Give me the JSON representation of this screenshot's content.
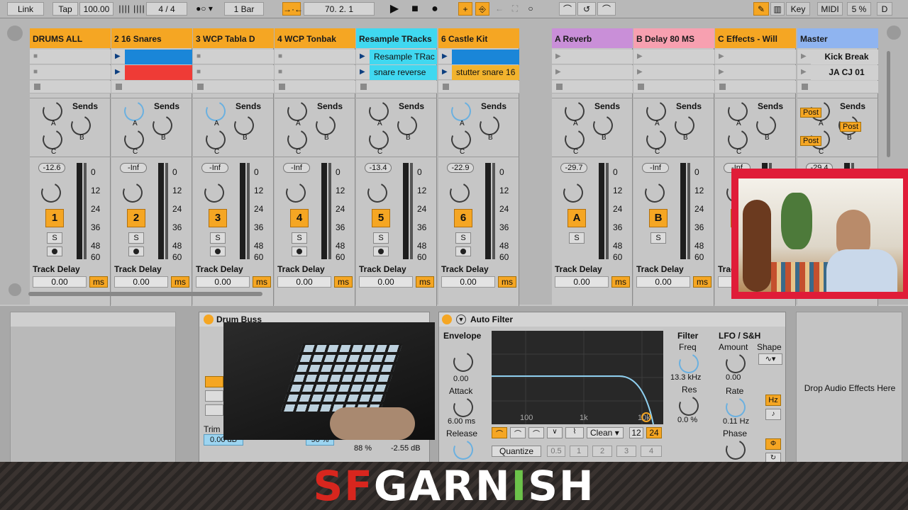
{
  "topbar": {
    "link": "Link",
    "tap": "Tap",
    "tempo": "100.00",
    "signature": "4 / 4",
    "quantize": "1 Bar",
    "position": "70.  2.  1",
    "key": "Key",
    "midi": "MIDI",
    "cpu": "5 %",
    "d": "D"
  },
  "tracks": [
    {
      "title": "DRUMS ALL",
      "color": "#f5a623",
      "clips": [
        "",
        ""
      ],
      "vol": "-12.6",
      "num": "1"
    },
    {
      "title": "2 16 Snares",
      "color": "#f5a623",
      "clips": [
        "",
        ""
      ],
      "vol": "-Inf",
      "num": "2"
    },
    {
      "title": "3 WCP  Tabla  D",
      "color": "#f5a623",
      "clips": [
        "",
        ""
      ],
      "vol": "-Inf",
      "num": "3"
    },
    {
      "title": "4 WCP  Tonbak",
      "color": "#f5a623",
      "clips": [
        "",
        ""
      ],
      "vol": "-Inf",
      "num": "4"
    },
    {
      "title": "Resample TRacks",
      "color": "#40d8f0",
      "clips": [
        "Resample TRac",
        "snare reverse"
      ],
      "vol": "-13.4",
      "num": "5"
    },
    {
      "title": "6 Castle Kit",
      "color": "#f5a623",
      "clips": [
        "",
        "stutter snare 16"
      ],
      "vol": "-22.9",
      "num": "6"
    },
    {
      "title": "A Reverb",
      "color": "#c98fd8",
      "clips": [
        "",
        ""
      ],
      "vol": "-29.7",
      "num": "A"
    },
    {
      "title": "B Delay 80 MS",
      "color": "#f7a0b0",
      "clips": [
        "",
        ""
      ],
      "vol": "-Inf",
      "num": "B"
    },
    {
      "title": "C Effects - Will",
      "color": "#f5a623",
      "clips": [
        "",
        ""
      ],
      "vol": "-Inf",
      "num": "C"
    },
    {
      "title": "Master",
      "color": "#8fb4f0",
      "clips": [
        "Kick Break",
        "JA CJ 01"
      ],
      "vol": "-29.4",
      "num": ""
    }
  ],
  "mixer": {
    "sends": "Sends",
    "track_delay": "Track Delay",
    "delay_value": "0.00",
    "ms": "ms",
    "solo": "S",
    "post": "Post",
    "scale": [
      "0",
      "12",
      "24",
      "36",
      "48",
      "60"
    ]
  },
  "devices": {
    "drum_buss": "Drum Buss",
    "auto_filter": "Auto Filter",
    "envelope": "Envelope",
    "env_amount": "0.00",
    "attack": "Attack",
    "attack_val": "6.00 ms",
    "release": "Release",
    "filter": "Filter",
    "freq": "Freq",
    "freq_val": "13.3 kHz",
    "res": "Res",
    "res_val": "0.0 %",
    "lfo": "LFO / S&H",
    "amount": "Amount",
    "amount_val": "0.00",
    "shape": "Shape",
    "rate": "Rate",
    "rate_val": "0.11 Hz",
    "phase": "Phase",
    "hz": "Hz",
    "clean": "Clean",
    "n12": "12",
    "n24": "24",
    "quantize": "Quantize",
    "q": [
      "0.5",
      "1",
      "2",
      "3",
      "4"
    ],
    "axis": [
      "100",
      "1k",
      "10k"
    ],
    "drop": "Drop Audio Effects Here",
    "trim": "Trim",
    "trim_val": "0.00 dB",
    "dry_wet": "88 %",
    "gain_val": "-2.55 dB",
    "pct": "90 %"
  },
  "logo": "SFGARNISH"
}
